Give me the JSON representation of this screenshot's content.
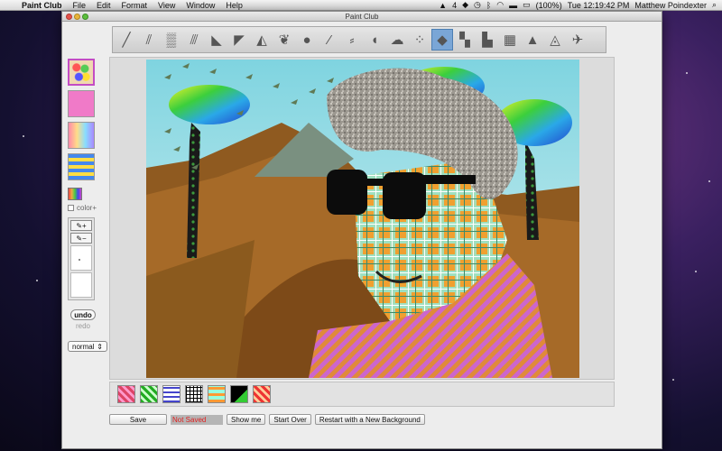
{
  "menubar": {
    "app_name": "Paint Club",
    "items": [
      "File",
      "Edit",
      "Format",
      "View",
      "Window",
      "Help"
    ],
    "status_number": "4",
    "battery": "(100%)",
    "clock": "Tue 12:19:42 PM",
    "user": "Matthew Poindexter"
  },
  "window": {
    "title": "Paint Club"
  },
  "toolbar": {
    "tools": [
      "brush-pen",
      "brush-hair",
      "texture-noise",
      "brush-stripes",
      "stamp-cat",
      "stamp-bird",
      "stamp-wolf",
      "stamp-leaf",
      "shape-circle",
      "brush-feather",
      "brush-grass",
      "shape-blob",
      "shape-cloud",
      "shape-bubbles",
      "shape-cube",
      "shape-check",
      "shape-steps",
      "shape-grid",
      "shape-triangle",
      "shape-mountain",
      "shape-plane"
    ],
    "selected_index": 14
  },
  "left_panel": {
    "color_option_label": "color+",
    "undo_label": "undo",
    "redo_label": "redo",
    "mode_value": "normal"
  },
  "bottom": {
    "save_label": "Save",
    "status_text": "Not Saved",
    "show_me_label": "Show me",
    "start_over_label": "Start Over",
    "restart_label": "Restart with a New Background"
  },
  "colors": {
    "sky": "#bde8ee",
    "hills": "#8f5a20",
    "plaid": "#f0a030",
    "shirt": "#cc66cc",
    "hair": "#9c9890",
    "not_saved": "#e02020",
    "selection": "#7aa6d6"
  }
}
